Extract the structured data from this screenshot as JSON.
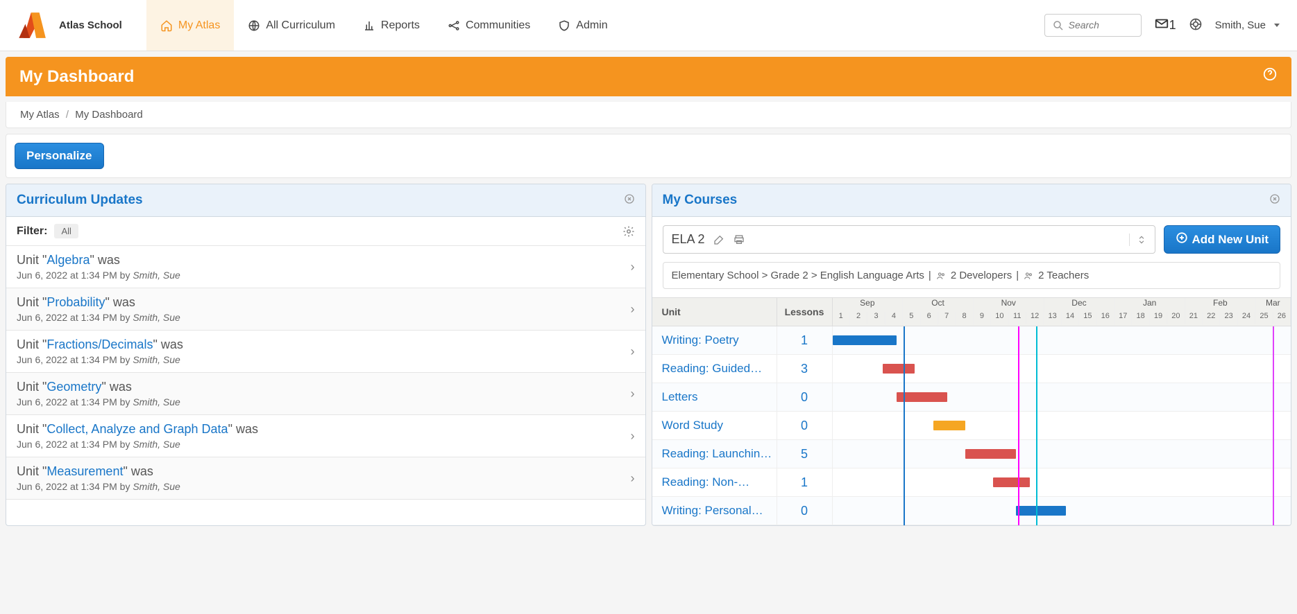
{
  "app_name": "Atlas School",
  "nav": {
    "my_atlas": "My Atlas",
    "all_curriculum": "All Curriculum",
    "reports": "Reports",
    "communities": "Communities",
    "admin": "Admin"
  },
  "search_placeholder": "Search",
  "message_count": "1",
  "user_name": "Smith, Sue",
  "page_title": "My Dashboard",
  "breadcrumb": {
    "root": "My Atlas",
    "current": "My Dashboard"
  },
  "personalize_label": "Personalize",
  "left_panel": {
    "title": "Curriculum Updates",
    "filter_label": "Filter:",
    "filter_all": "All",
    "items": [
      {
        "prefix": "Unit \"",
        "name": "Algebra",
        "suffix": "\" was",
        "meta_time": "Jun 6, 2022 at 1:34 PM by ",
        "author": "Smith, Sue"
      },
      {
        "prefix": "Unit \"",
        "name": "Probability",
        "suffix": "\" was",
        "meta_time": "Jun 6, 2022 at 1:34 PM by ",
        "author": "Smith, Sue"
      },
      {
        "prefix": "Unit \"",
        "name": "Fractions/Decimals",
        "suffix": "\" was",
        "meta_time": "Jun 6, 2022 at 1:34 PM by ",
        "author": "Smith, Sue"
      },
      {
        "prefix": "Unit \"",
        "name": "Geometry",
        "suffix": "\" was",
        "meta_time": "Jun 6, 2022 at 1:34 PM by ",
        "author": "Smith, Sue"
      },
      {
        "prefix": "Unit \"",
        "name": "Collect, Analyze and Graph Data",
        "suffix": "\" was",
        "meta_time": "Jun 6, 2022 at 1:34 PM by ",
        "author": "Smith, Sue"
      },
      {
        "prefix": "Unit \"",
        "name": "Measurement",
        "suffix": "\" was",
        "meta_time": "Jun 6, 2022 at 1:34 PM by ",
        "author": "Smith, Sue"
      }
    ]
  },
  "right_panel": {
    "title": "My Courses",
    "selected_course": "ELA 2",
    "add_unit_label": "Add New Unit",
    "meta_path": "Elementary School > Grade 2 > English Language Arts",
    "developers": "2 Developers",
    "teachers": "2 Teachers",
    "col_unit": "Unit",
    "col_lessons": "Lessons",
    "months": [
      "Sep",
      "Oct",
      "Nov",
      "Dec",
      "Jan",
      "Feb",
      "Mar"
    ],
    "weeks": [
      "1",
      "2",
      "3",
      "4",
      "5",
      "6",
      "7",
      "8",
      "9",
      "10",
      "11",
      "12",
      "13",
      "14",
      "15",
      "16",
      "17",
      "18",
      "19",
      "20",
      "21",
      "22",
      "23",
      "24",
      "25",
      "26"
    ],
    "rows": [
      {
        "unit": "Writing: Poetry",
        "lessons": "1",
        "bar_color": "blue",
        "bar_left_pct": 0,
        "bar_width_pct": 14
      },
      {
        "unit": "Reading: Guided…",
        "lessons": "3",
        "bar_color": "red",
        "bar_left_pct": 11,
        "bar_width_pct": 7
      },
      {
        "unit": "Letters",
        "lessons": "0",
        "bar_color": "red",
        "bar_left_pct": 14,
        "bar_width_pct": 11
      },
      {
        "unit": "Word Study",
        "lessons": "0",
        "bar_color": "orange",
        "bar_left_pct": 22,
        "bar_width_pct": 7
      },
      {
        "unit": "Reading: Launchin…",
        "lessons": "5",
        "bar_color": "red",
        "bar_left_pct": 29,
        "bar_width_pct": 11
      },
      {
        "unit": "Reading: Non-…",
        "lessons": "1",
        "bar_color": "red",
        "bar_left_pct": 35,
        "bar_width_pct": 8
      },
      {
        "unit": "Writing: Personal…",
        "lessons": "0",
        "bar_color": "blue",
        "bar_left_pct": 40,
        "bar_width_pct": 11
      }
    ]
  }
}
